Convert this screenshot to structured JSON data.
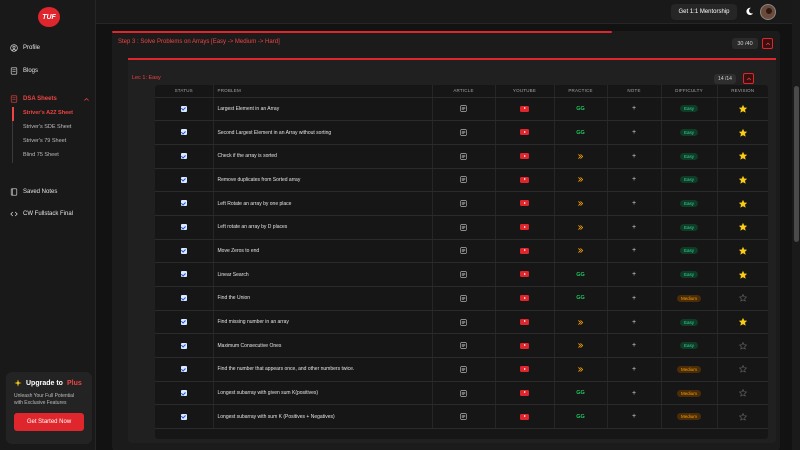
{
  "logo": {
    "text": "TUF"
  },
  "sidebar": {
    "profile": "Profile",
    "blogs": "Blogs",
    "dsa_sheets": "DSA Sheets",
    "sheets": [
      "Striver's A2Z Sheet",
      "Striver's SDE Sheet",
      "Striver's 79 Sheet",
      "Blind 75 Sheet"
    ],
    "saved_notes": "Saved Notes",
    "cw_fullstack": "CW Fullstack Final",
    "upgrade": {
      "title_prefix": "Upgrade to",
      "title_plus": "Plus",
      "desc": "Unleash Your Full Potential with Exclusive Features",
      "button": "Get Started Now"
    }
  },
  "header": {
    "mentorship": "Get 1:1 Mentorship"
  },
  "step": {
    "title": "Step 3 : Solve Problems on Arrays [Easy -> Medium -> Hard]",
    "count": "30 /40"
  },
  "lecture": {
    "title": "Lec 1: Easy",
    "count": "14 /14"
  },
  "table": {
    "headers": [
      "STATUS",
      "PROBLEM",
      "ARTICLE",
      "YOUTUBE",
      "PRACTICE",
      "NOTE",
      "DIFFICULTY",
      "REVISION"
    ],
    "rows": [
      {
        "problem": "Largest Element in an Array",
        "practice": "gfg",
        "difficulty": "Easy",
        "starred": true
      },
      {
        "problem": "Second Largest Element in an Array without sorting",
        "practice": "gfg",
        "difficulty": "Easy",
        "starred": true
      },
      {
        "problem": "Check if the array is sorted",
        "practice": "cn",
        "difficulty": "Easy",
        "starred": true
      },
      {
        "problem": "Remove duplicates from Sorted array",
        "practice": "cn",
        "difficulty": "Easy",
        "starred": true
      },
      {
        "problem": "Left Rotate an array by one place",
        "practice": "cn",
        "difficulty": "Easy",
        "starred": true
      },
      {
        "problem": "Left rotate an array by D places",
        "practice": "cn",
        "difficulty": "Easy",
        "starred": true
      },
      {
        "problem": "Move Zeros to end",
        "practice": "cn",
        "difficulty": "Easy",
        "starred": true
      },
      {
        "problem": "Linear Search",
        "practice": "gfg",
        "difficulty": "Easy",
        "starred": true
      },
      {
        "problem": "Find the Union",
        "practice": "gfg",
        "difficulty": "Medium",
        "starred": false
      },
      {
        "problem": "Find missing number in an array",
        "practice": "cn",
        "difficulty": "Easy",
        "starred": true
      },
      {
        "problem": "Maximum Consecutive Ones",
        "practice": "cn",
        "difficulty": "Easy",
        "starred": false
      },
      {
        "problem": "Find the number that appears once, and other numbers twice.",
        "practice": "cn",
        "difficulty": "Medium",
        "starred": false
      },
      {
        "problem": "Longest subarray with given sum K(positives)",
        "practice": "gfg",
        "difficulty": "Medium",
        "starred": false
      },
      {
        "problem": "Longest subarray with sum K (Positives + Negatives)",
        "practice": "gfg",
        "difficulty": "Medium",
        "starred": false
      }
    ]
  },
  "icons": {
    "gfg_label": "GG",
    "note_label": "+"
  },
  "colors": {
    "accent": "#e0262d",
    "easy": "#34d399",
    "medium": "#f59e0b",
    "star": "#facc15"
  }
}
